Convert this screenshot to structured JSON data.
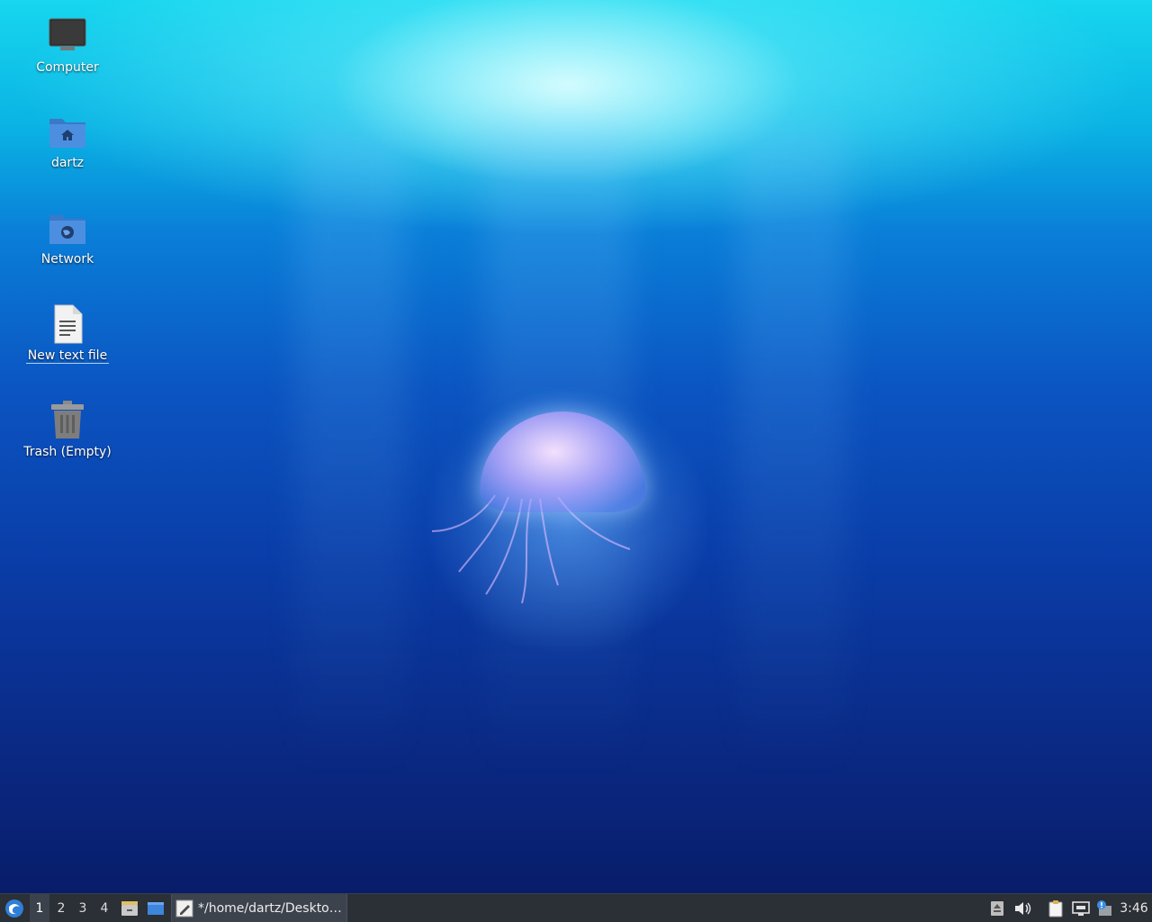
{
  "desktop": {
    "icons": [
      {
        "label": "Computer",
        "icon": "computer-icon"
      },
      {
        "label": "dartz",
        "icon": "home-folder-icon"
      },
      {
        "label": "Network",
        "icon": "network-folder-icon"
      },
      {
        "label": "New text file",
        "icon": "text-file-icon"
      },
      {
        "label": "Trash (Empty)",
        "icon": "trash-icon"
      }
    ]
  },
  "panel": {
    "menu_icon": "menu-logo-icon",
    "workspaces": [
      "1",
      "2",
      "3",
      "4"
    ],
    "active_workspace": "1",
    "launchers": [
      {
        "icon": "file-manager-icon"
      },
      {
        "icon": "show-desktop-icon"
      }
    ],
    "task": {
      "label": "*/home/dartz/Deskto…",
      "icon": "text-editor-icon"
    },
    "tray": [
      {
        "icon": "eject-icon"
      },
      {
        "icon": "volume-icon"
      },
      {
        "icon": "clipboard-icon"
      },
      {
        "icon": "network-wired-icon"
      },
      {
        "icon": "update-notifier-icon"
      }
    ],
    "clock": "3:46"
  },
  "colors": {
    "panel_bg": "#2b2f36",
    "folder_blue": "#4c8fe0",
    "water_top": "#17d6ee",
    "water_bottom": "#081d6a"
  }
}
